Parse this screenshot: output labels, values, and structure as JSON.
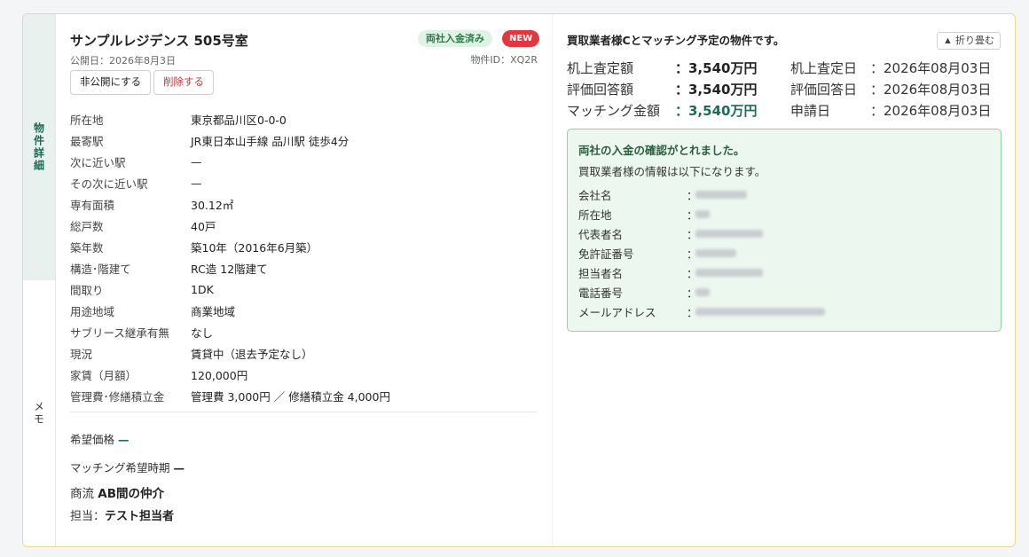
{
  "tabs": {
    "detail": "物件詳細",
    "memo": "メモ"
  },
  "property": {
    "title": "サンプルレジデンス 505号室",
    "published": "公開日：2026年8月3日",
    "badge_paid": "両社入金済み",
    "badge_new": "NEW",
    "property_id": "物件ID：XQ2R",
    "btn_private": "非公開にする",
    "btn_delete": "削除する"
  },
  "details": [
    {
      "label": "所在地",
      "value": "東京都品川区0-0-0"
    },
    {
      "label": "最寄駅",
      "value": "JR東日本山手線 品川駅 徒歩4分"
    },
    {
      "label": "次に近い駅",
      "value": "—"
    },
    {
      "label": "その次に近い駅",
      "value": "—"
    },
    {
      "label": "専有面積",
      "value": "30.12㎡"
    },
    {
      "label": "総戸数",
      "value": "40戸"
    },
    {
      "label": "築年数",
      "value": "築10年（2016年6月築）"
    },
    {
      "label": "構造･階建て",
      "value": "RC造 12階建て"
    },
    {
      "label": "間取り",
      "value": "1DK"
    },
    {
      "label": "用途地域",
      "value": "商業地域"
    },
    {
      "label": "サブリース継承有無",
      "value": "なし"
    },
    {
      "label": "現況",
      "value": "賃貸中（退去予定なし）"
    },
    {
      "label": "家賃（月額）",
      "value": "120,000円"
    },
    {
      "label": "管理費･修繕積立金",
      "value": "管理費 3,000円 ／ 修繕積立金 4,000円"
    }
  ],
  "extra": {
    "desired_price_label": "希望価格",
    "desired_price_value": "—",
    "matching_period_label": "マッチング希望時期",
    "matching_period_value": "—",
    "flow_label": "商流",
    "flow_value": "AB間の仲介",
    "staff_label": "担当：",
    "staff_value": "テスト担当者"
  },
  "matching": {
    "title": "買取業者様Cとマッチング予定の物件です。",
    "collapse": "▲ 折り畳む",
    "rows": [
      {
        "k": "机上査定額",
        "v": "：3,540万円",
        "dk": "机上査定日",
        "dv": "：2026年08月03日",
        "green": false
      },
      {
        "k": "評価回答額",
        "v": "：3,540万円",
        "dk": "評価回答日",
        "dv": "：2026年08月03日",
        "green": false
      },
      {
        "k": "マッチング金額",
        "v": "：3,540万円",
        "dk": "申請日",
        "dv": "：2026年08月03日",
        "green": true
      }
    ],
    "accent_green": "#1e6b55"
  },
  "buyer_info": {
    "head": "両社の入金の確認がとれました。",
    "sub": "買取業者様の情報は以下になります。",
    "fields": [
      {
        "k": "会社名"
      },
      {
        "k": "所在地"
      },
      {
        "k": "代表者名"
      },
      {
        "k": "免許証番号"
      },
      {
        "k": "担当者名"
      },
      {
        "k": "電話番号"
      },
      {
        "k": "メールアドレス"
      }
    ],
    "separator": "："
  }
}
